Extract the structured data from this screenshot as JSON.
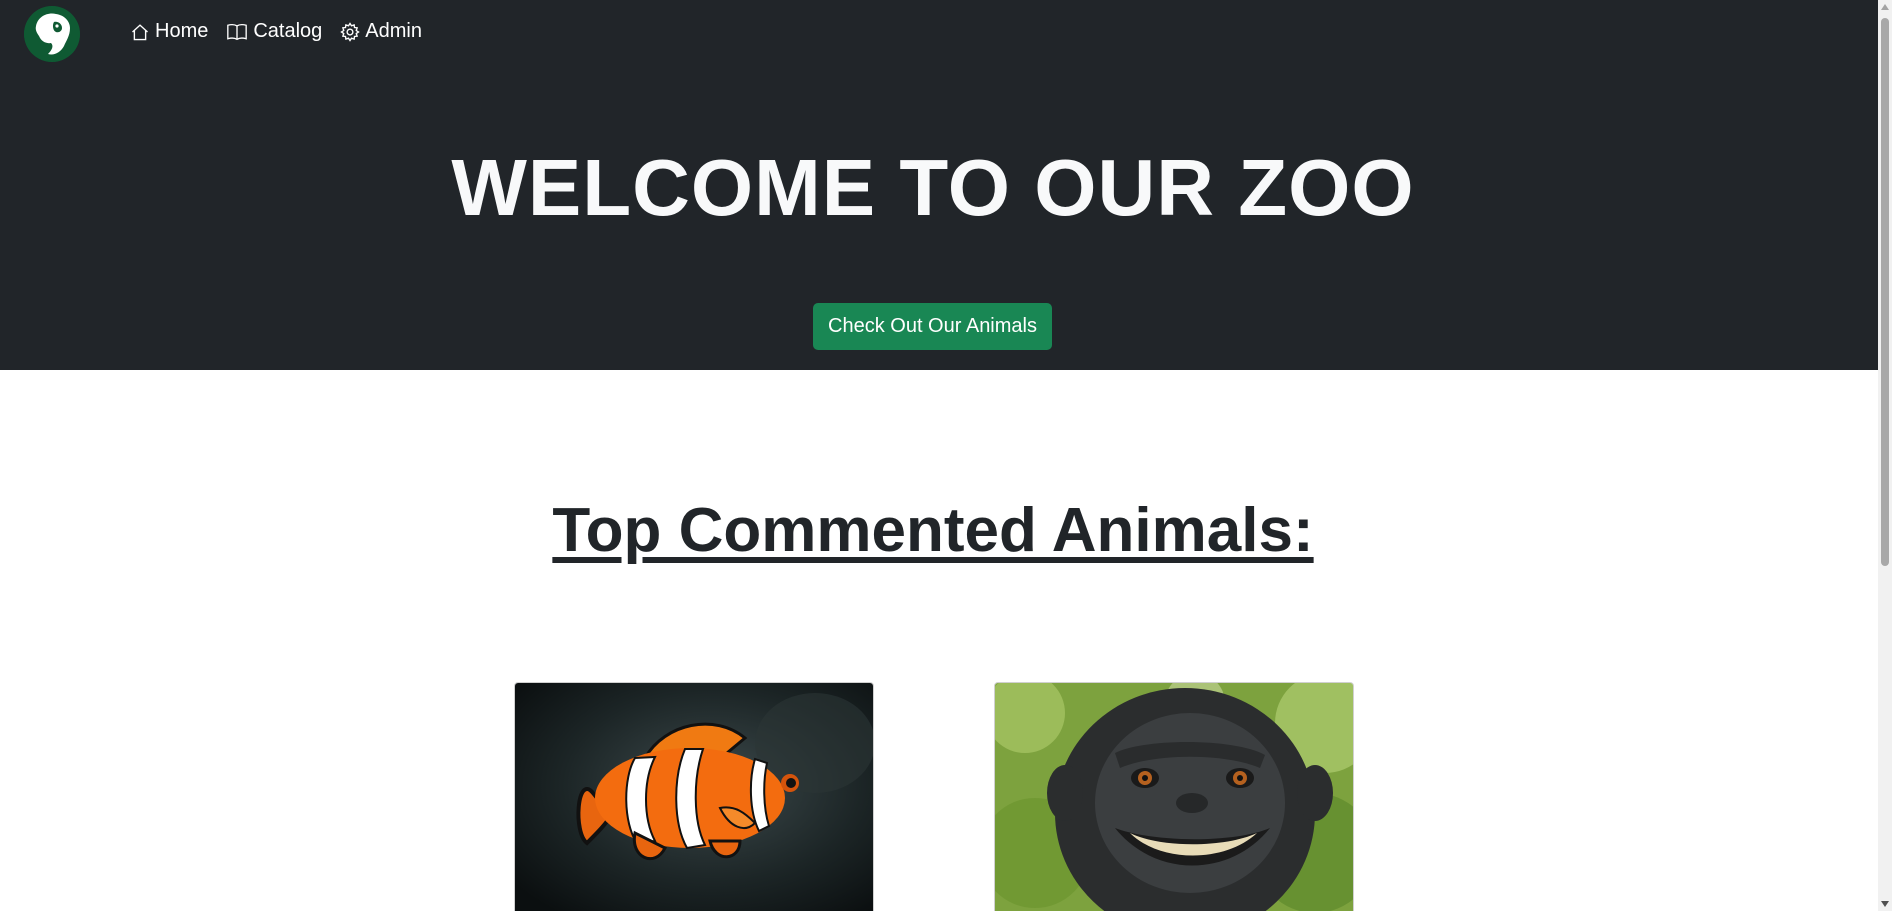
{
  "nav": {
    "logo_icon": "lion-logo-icon",
    "items": [
      {
        "label": "Home",
        "icon": "house-icon"
      },
      {
        "label": "Catalog",
        "icon": "book-icon"
      },
      {
        "label": "Admin",
        "icon": "gear-icon"
      }
    ]
  },
  "hero": {
    "title": "WELCOME TO OUR ZOO",
    "cta_label": "Check Out Our Animals"
  },
  "section": {
    "title": "Top Commented Animals:"
  },
  "animals": [
    {
      "image": "clownfish-photo"
    },
    {
      "image": "macaque-monkey-photo"
    }
  ],
  "colors": {
    "header_bg": "#212529",
    "accent_green": "#198754",
    "logo_green": "#0f5a33",
    "heading_dark": "#212529"
  }
}
